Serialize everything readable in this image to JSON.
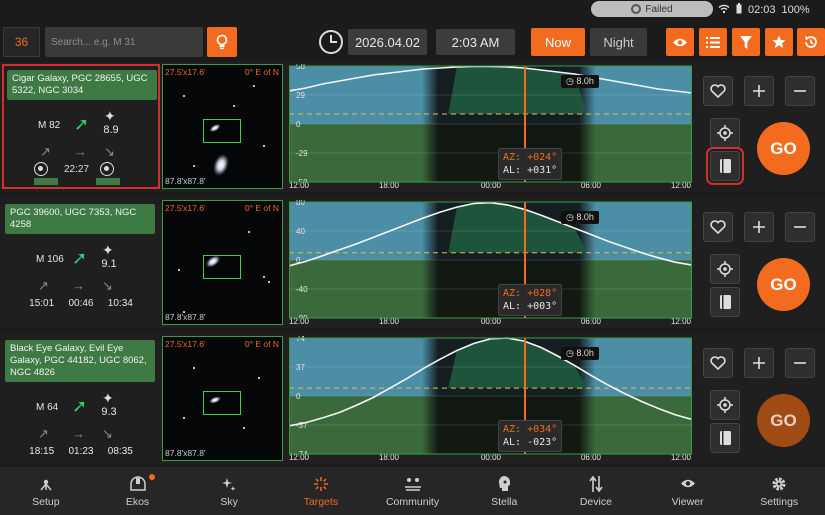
{
  "status": {
    "badge": "Failed",
    "time": "02:03",
    "battery": "100%"
  },
  "toolbar": {
    "count": "36",
    "search_placeholder": "Search... e.g. M 31",
    "date": "2026.04.02",
    "time": "2:03 AM",
    "now_label": "Now",
    "night_label": "Night"
  },
  "chart_axis": {
    "ticks": [
      "12:00",
      "18:00",
      "00:00",
      "06:00",
      "12:00"
    ]
  },
  "targets": [
    {
      "name": "Cigar Galaxy, PGC 28655, UGC 5322, NGC 3034",
      "messier": "M 82",
      "magnitude": "8.9",
      "rise": "",
      "transit": "22:27",
      "set": "",
      "circumpolar": true,
      "fov": "27.5'x17.6'",
      "pa": "0° E of N",
      "fov2": "87.8'x87.8'",
      "duration": "8.0h",
      "az": "AZ: +024°",
      "al": "AL: +031°",
      "yticks": [
        "58",
        "29",
        "0",
        "-29",
        "-58"
      ],
      "ymax": 58,
      "selected": true,
      "curve": [
        33,
        36,
        40,
        43,
        46,
        49,
        51,
        53,
        55,
        56,
        57,
        57.5,
        57.5,
        57,
        56,
        54,
        52,
        50,
        47,
        44,
        41,
        38,
        35,
        33,
        31
      ],
      "min_alt": 10,
      "go_dim": false
    },
    {
      "name": "PGC 39600, UGC 7353, NGC 4258",
      "messier": "M 106",
      "magnitude": "9.1",
      "rise": "15:01",
      "transit": "00:46",
      "set": "10:34",
      "circumpolar": false,
      "fov": "27.5'x17.6'",
      "pa": "0° E of N",
      "fov2": "87.8'x87.8'",
      "duration": "8.0h",
      "az": "AZ: +028°",
      "al": "AL: +003°",
      "yticks": [
        "80",
        "40",
        "0",
        "-40",
        "-80"
      ],
      "ymax": 80,
      "selected": false,
      "curve": [
        -8,
        -2,
        6,
        14,
        22,
        31,
        40,
        49,
        58,
        66,
        73,
        78,
        79,
        76,
        70,
        62,
        53,
        44,
        35,
        26,
        18,
        10,
        3,
        -3,
        -7
      ],
      "min_alt": 10,
      "go_dim": false
    },
    {
      "name": "Black Eye Galaxy, Evil Eye Galaxy, PGC 44182, UGC 8062, NGC 4826",
      "messier": "M 64",
      "magnitude": "9.3",
      "rise": "18:15",
      "transit": "01:23",
      "set": "08:35",
      "circumpolar": false,
      "fov": "27.5'x17.6'",
      "pa": "0° E of N",
      "fov2": "87.8'x87.8'",
      "duration": "8.0h",
      "az": "AZ: +034°",
      "al": "AL: -023°",
      "yticks": [
        "74",
        "37",
        "0",
        "-37",
        "-74"
      ],
      "ymax": 74,
      "selected": false,
      "curve": [
        -38,
        -34,
        -28,
        -21,
        -12,
        -2,
        10,
        22,
        35,
        47,
        58,
        67,
        73,
        74,
        70,
        62,
        51,
        39,
        26,
        14,
        3,
        -7,
        -16,
        -24,
        -30
      ],
      "min_alt": 10,
      "go_dim": true
    }
  ],
  "nav": [
    {
      "label": "Setup",
      "icon": "setup-icon"
    },
    {
      "label": "Ekos",
      "icon": "ekos-icon"
    },
    {
      "label": "Sky",
      "icon": "sky-icon"
    },
    {
      "label": "Targets",
      "icon": "targets-icon"
    },
    {
      "label": "Community",
      "icon": "community-icon"
    },
    {
      "label": "Stella",
      "icon": "stella-icon"
    },
    {
      "label": "Device",
      "icon": "device-icon"
    },
    {
      "label": "Viewer",
      "icon": "viewer-icon"
    },
    {
      "label": "Settings",
      "icon": "settings-icon"
    }
  ],
  "colors": {
    "accent": "#f26b1f",
    "green": "#3e7a44",
    "sky": "#4b8ea6",
    "ground": "#3a6a3c"
  }
}
